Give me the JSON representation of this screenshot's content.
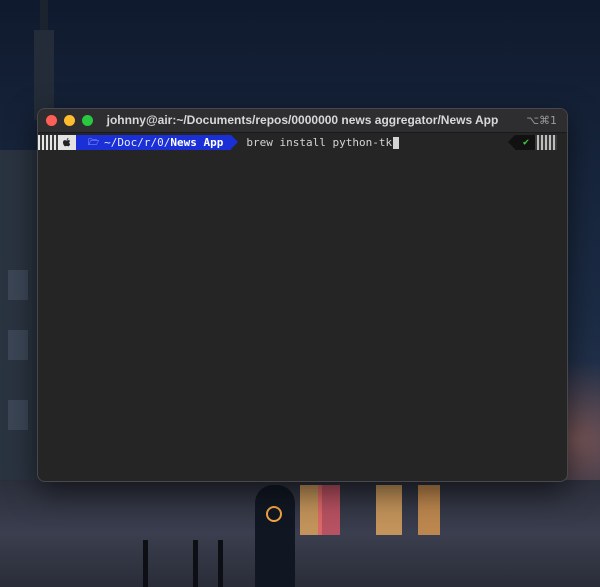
{
  "window": {
    "title": "johnny@air:~/Documents/repos/0000000 news aggregator/News App",
    "shortcut": "⌥⌘1"
  },
  "prompt": {
    "os_icon": "apple-icon",
    "dir_icon": "folder-icon",
    "path_prefix": "~/Doc/r/0/",
    "path_current": "News App",
    "command": "brew install python-tk",
    "status_icon": "checkmark-icon",
    "status_symbol": "✔"
  },
  "colors": {
    "dir_segment": "#1a2fd6",
    "status_ok": "#3ad33a",
    "terminal_bg": "#252526"
  }
}
